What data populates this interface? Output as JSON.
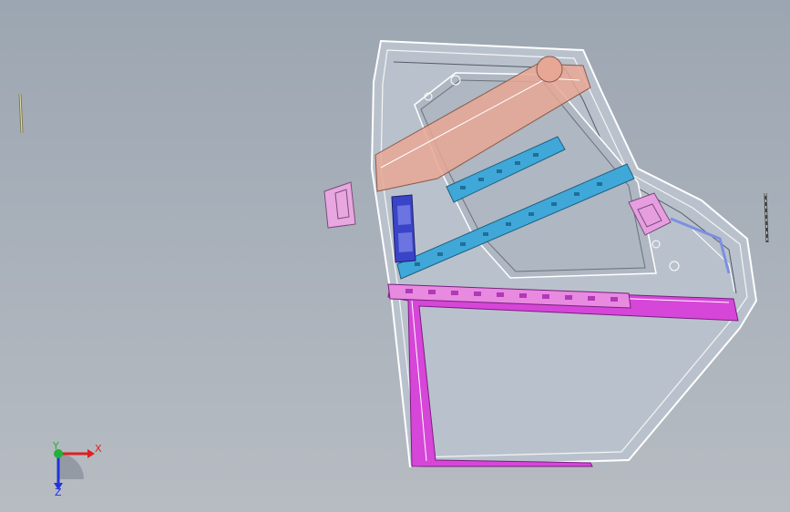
{
  "axis_triad": {
    "x_label": "X",
    "y_label": "Y",
    "z_label": "Z",
    "x_color": "#e0201e",
    "y_color": "#22b03a",
    "z_color": "#2233d8"
  },
  "colors": {
    "background_top": "#9ca6b1",
    "background_bottom": "#b7bcc2",
    "frame_outline": "#ffffff",
    "reinforcement_beam": "#e7a794",
    "impact_beam": "#3fa8d8",
    "hinge_bracket": "#3a44c8",
    "window_frame": "#d03ad8",
    "latch_bracket": "#e79ee0"
  },
  "parts": [
    "door-inner-panel",
    "upper-reinforcement-beam",
    "impact-beam-upper",
    "impact-beam-lower",
    "hinge-reinforcement",
    "belt-line-reinforcement",
    "window-frame",
    "latch-bracket",
    "mirror-bracket",
    "seal-strip-left",
    "seal-strip-right"
  ]
}
